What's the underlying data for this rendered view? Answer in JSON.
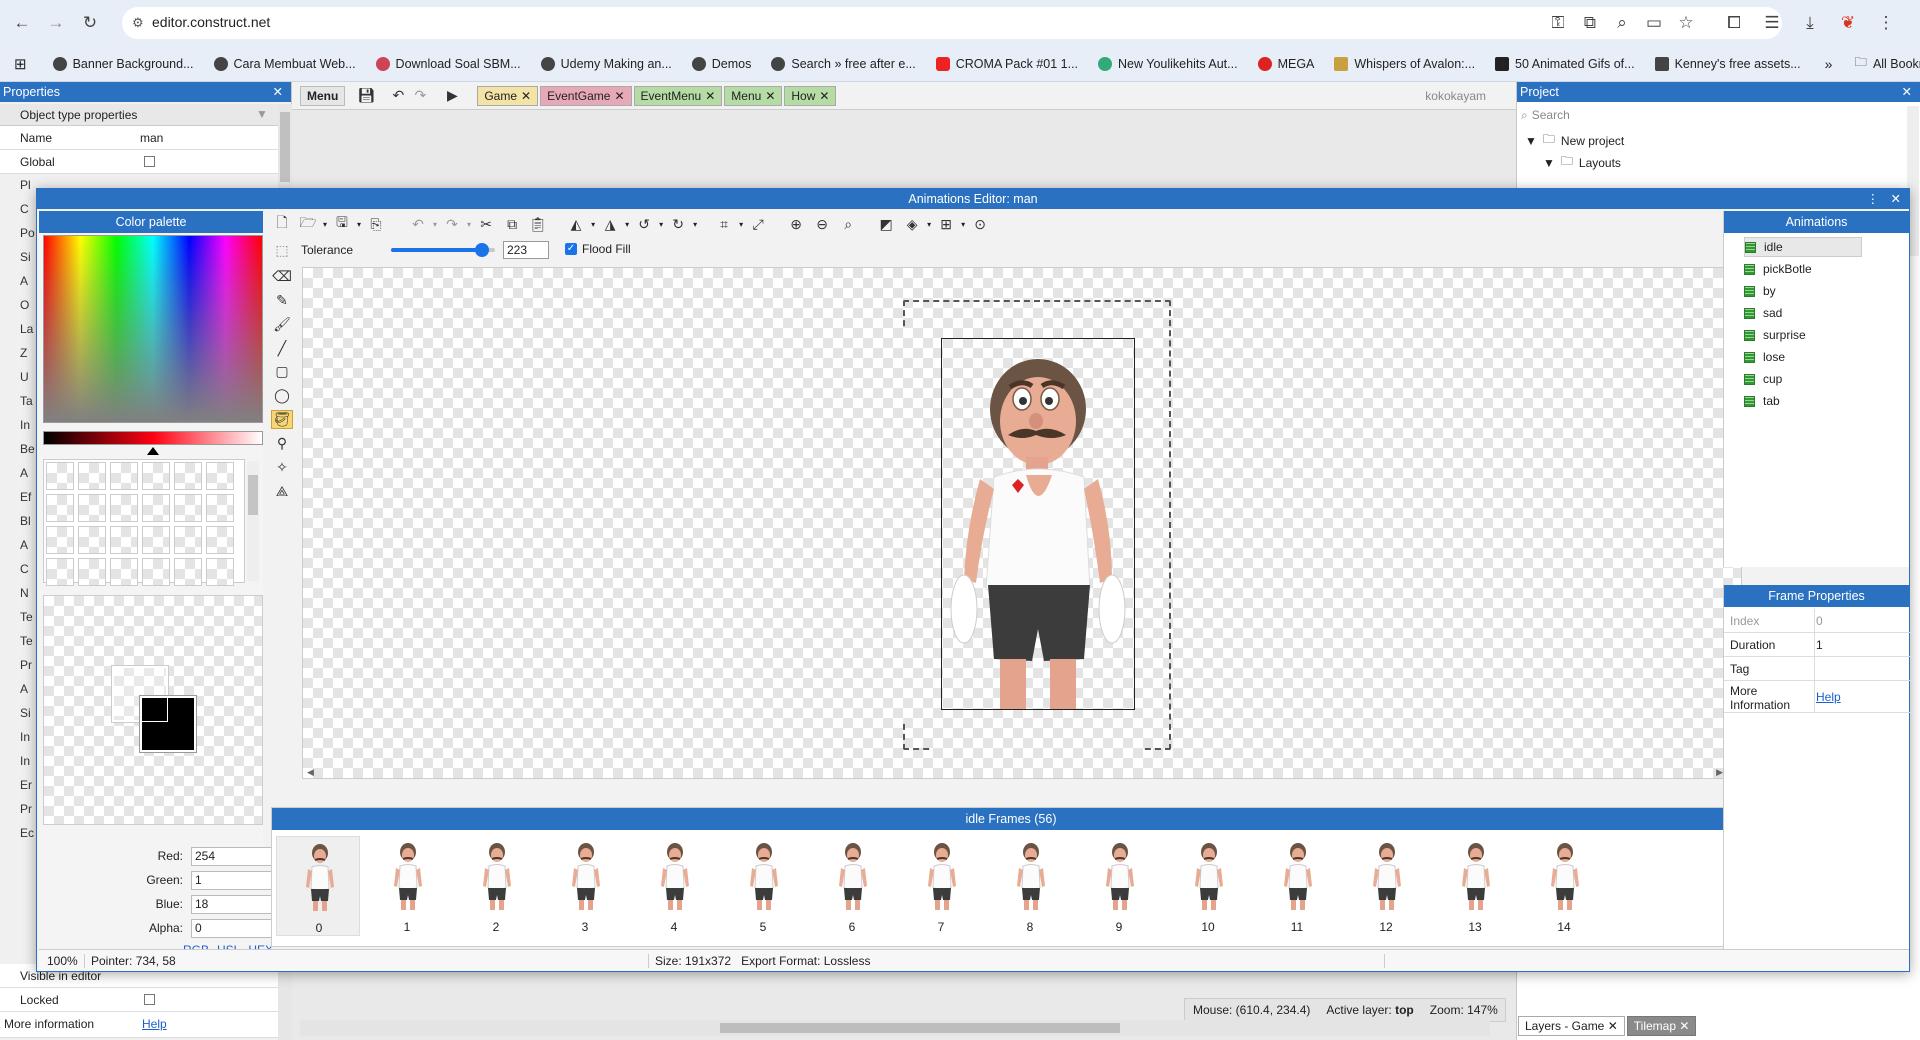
{
  "browser": {
    "url": "editor.construct.net",
    "bookmarks": [
      "Banner Background...",
      "Cara Membuat Web...",
      "Download Soal SBM...",
      "Udemy Making an...",
      "Demos",
      "Search » free after e...",
      "CROMA Pack #01 1...",
      "New Youlikehits Aut...",
      "MEGA",
      "Whispers of Avalon:...",
      "50 Animated Gifs of...",
      "Kenney's free assets..."
    ],
    "all_bookmarks": "All Bookmarks"
  },
  "properties": {
    "title": "Properties",
    "section": "Object type properties",
    "rows": [
      {
        "label": "Name",
        "value": "man"
      },
      {
        "label": "Global",
        "value": ""
      }
    ],
    "bottom_rows": [
      {
        "label": "Visible in editor",
        "value": ""
      },
      {
        "label": "Locked",
        "value": ""
      },
      {
        "label": "More information",
        "value": "Help"
      }
    ],
    "side_letters": [
      "Pl",
      "C",
      "Po",
      "Si",
      "A",
      "O",
      "La",
      "Z",
      "U",
      "Ta",
      "In",
      "Be",
      "A",
      "Ef",
      "Bl",
      "A",
      "C",
      "N",
      "Te",
      "Te",
      "Pr",
      "A",
      "Si",
      "In",
      "In",
      "Er",
      "Pr",
      "Ec"
    ]
  },
  "menu": {
    "menu_label": "Menu",
    "tabs": [
      {
        "label": "Game",
        "color": "#f3e3a6"
      },
      {
        "label": "EventGame",
        "color": "#e7a9b8"
      },
      {
        "label": "EventMenu",
        "color": "#b6dca6"
      },
      {
        "label": "Menu",
        "color": "#b6dca6"
      },
      {
        "label": "How",
        "color": "#b6dca6"
      }
    ],
    "user": "kokokayam"
  },
  "project": {
    "title": "Project",
    "search_placeholder": "Search",
    "tree": [
      "New project",
      "Layouts"
    ]
  },
  "status": {
    "mouse": "Mouse: (610.4, 234.4)",
    "layer_label": "Active layer:",
    "layer": "top",
    "zoom": "Zoom: 147%",
    "tabs": [
      "Layers - Game",
      "Tilemap"
    ]
  },
  "dialog": {
    "title": "Animations Editor: man",
    "palette_title": "Color palette",
    "tolerance_label": "Tolerance",
    "tolerance_value": "223",
    "tolerance_fraction": 0.874,
    "flood_fill_label": "Flood Fill",
    "rgba": [
      {
        "label": "Red:",
        "value": "254"
      },
      {
        "label": "Green:",
        "value": "1"
      },
      {
        "label": "Blue:",
        "value": "18"
      },
      {
        "label": "Alpha:",
        "value": "0"
      }
    ],
    "color_modes": {
      "rgb": "RGB",
      "hsl": "HSL",
      "hex": "HEX",
      "sep": "-"
    },
    "animations_title": "Animations",
    "animations": [
      "idle",
      "pickBotle",
      "by",
      "sad",
      "surprise",
      "lose",
      "cup",
      "tab"
    ],
    "frame_props_title": "Frame Properties",
    "frame_props": [
      {
        "label": "Index",
        "value": "0"
      },
      {
        "label": "Duration",
        "value": "1"
      },
      {
        "label": "Tag",
        "value": ""
      },
      {
        "label": "More Information",
        "value": "Help"
      }
    ],
    "frames_title": "idle Frames (56)",
    "frames": [
      "0",
      "1",
      "2",
      "3",
      "4",
      "5",
      "6",
      "7",
      "8",
      "9",
      "10",
      "11",
      "12",
      "13",
      "14"
    ],
    "zoom": "100%",
    "pointer": "Pointer: 734, 58",
    "size": "Size: 191x372",
    "export": "Export Format: Lossless",
    "accent": "#2a71c1"
  }
}
